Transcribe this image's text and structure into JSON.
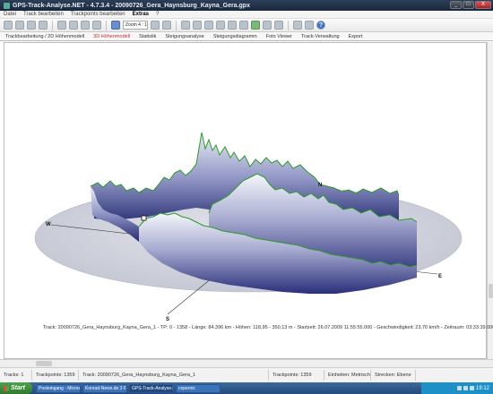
{
  "window": {
    "title": "GPS-Track-Analyse.NET  -  4.7.3.4  -  20090726_Gera_Haynsburg_Kayna_Gera.gpx",
    "controls": [
      "_",
      "□",
      "X"
    ]
  },
  "menu": [
    "Datei",
    "Track bearbeiten",
    "Trackpoints bearbeiten",
    "Extras",
    "?"
  ],
  "menu_active_index": 3,
  "toolbar": {
    "zoom_value": "Zoom 4 : 1",
    "help_label": "?"
  },
  "tabs": [
    "Trackbearbeitung / 2D Höhenmodell",
    "3D Höhenmodell",
    "Statistik",
    "Steigungsanalyse",
    "Steigungsdiagramm",
    "Foto Viewer",
    "Track-Verwaltung",
    "Export"
  ],
  "tab_active_index": 1,
  "plot": {
    "axis_labels": {
      "west": "W",
      "south": "S",
      "east": "E",
      "north": "N"
    }
  },
  "infoline": "Track: 20090726_Gera_Haynsburg_Kayna_Gera_1  -  TP: 0 - 1358  -  Länge: 84.396 km  -  Höhen: 118,95 - 350,13 m  -  Startzeit: 26.07.2009 11:55:55.000  -  Geschwindigkeit: 23,70 km/h  -  Zeitraum: 03:33:39.000",
  "status": [
    "Tracks: 1",
    "Trackpoints: 1359",
    "Track: 20090726_Gera_Haynsburg_Kayna_Gera_1",
    "Trackpoints: 1359",
    "Einheiten: Metrisch",
    "Strecken: Ebene"
  ],
  "taskbar": {
    "start_label": "Start",
    "buttons": [
      "Posteingang - Micros...",
      "Konrad-News.de 3 F...",
      "GPS-Track-Analyse.N...",
      "copernic"
    ],
    "active_index": 2,
    "clock": "19:12"
  },
  "colors": {
    "track_line": "#2c9a2c",
    "wall_top": "#f4f6fb",
    "wall_bottom": "#2a2f7a",
    "ground": "#c9cbd6"
  }
}
